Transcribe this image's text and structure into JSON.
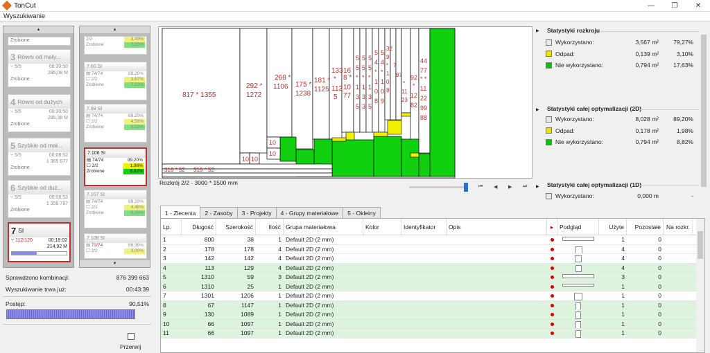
{
  "window": {
    "title": "TonCut",
    "min": "—",
    "max": "❐",
    "close": "✕"
  },
  "menu": {
    "search": "Wyszukiwanie"
  },
  "col1": {
    "top_status": "Zrobione",
    "cards": [
      {
        "num": "3",
        "name": "Równi od mały...",
        "count": "5/5",
        "time": "00:30:50",
        "val": "285,08 M",
        "status": "Zrobione"
      },
      {
        "num": "4",
        "name": "Równi od dużych",
        "count": "5/5",
        "time": "00:30:50",
        "val": "285,38 M",
        "status": "Zrobione"
      },
      {
        "num": "5",
        "name": "Szybkie od mał...",
        "count": "5/5",
        "time": "00:08:52",
        "val": "1 365 677",
        "status": "Zrobione"
      },
      {
        "num": "6",
        "name": "Szybkie od duż...",
        "count": "5/5",
        "time": "00:08:53",
        "val": "1 359 797",
        "status": "Zrobione"
      },
      {
        "num": "7",
        "name": "SI",
        "count": "112/120",
        "time": "00:18:02",
        "val": "214,92 M",
        "status": "",
        "progress": 0.45
      }
    ]
  },
  "col2": {
    "top": {
      "r1": "2/2",
      "v1": "3,49%",
      "v2": "7,30%",
      "status": "Zrobione"
    },
    "cards": [
      {
        "title": "7.60 SI",
        "a": "74/74",
        "va": "89,20%",
        "b": "2/2",
        "vb": "3,67%",
        "vc": "7,13%",
        "status": "Zrobione"
      },
      {
        "title": "7.99 SI",
        "a": "74/74",
        "va": "89,20%",
        "b": "2/2",
        "vb": "4,58%",
        "vc": "6,22%",
        "status": "Zrobione"
      },
      {
        "title": "7.106 SI",
        "a": "74/74",
        "va": "89,20%",
        "b": "2/2",
        "vb": "1,98%",
        "vc": "8,82%",
        "status": "Zrobione"
      },
      {
        "title": "7.107 SI",
        "a": "74/74",
        "va": "89,20%",
        "b": "2/2",
        "vb": "4,46%",
        "vc": "6,34%",
        "status": "Zrobione"
      },
      {
        "title": "7.108 SI",
        "a": "73/74",
        "va": "88,39%",
        "b": "2/2",
        "vb": "3,00%",
        "vc": ""
      }
    ]
  },
  "stats": {
    "checked_label": "Sprawdzono kombinacji:",
    "checked_val": "876 399 663",
    "time_label": "Wyszukiwanie trwa już:",
    "time_val": "00:43:39",
    "progress_label": "Postęp:",
    "progress_val": "90,51%",
    "progress": 0.9051,
    "stop": "Przerwij"
  },
  "viewer": {
    "caption": "Rozkrój 2/2 - 3000 * 1500 mm",
    "labels": [
      "817 * 1355",
      "292 *\n1272",
      "268 *\n1106",
      "175 *\n1238",
      "181 *\n1125",
      "133\n*\n113\n5",
      "16\n8 *\n10\n77"
    ],
    "small": [
      "316 * 52",
      "316 * 52",
      "10",
      "10",
      "10",
      "10"
    ]
  },
  "right": {
    "sect1": "Statystyki rozkroju",
    "s1": [
      {
        "label": "Wykorzystano:",
        "a": "3,567 m²",
        "b": "79,27%",
        "color": "#e8e8e8"
      },
      {
        "label": "Odpad:",
        "a": "0,139 m²",
        "b": "3,10%",
        "color": "#e5e500"
      },
      {
        "label": "Nie wykorzystano:",
        "a": "0,794 m²",
        "b": "17,63%",
        "color": "#10c010"
      }
    ],
    "sect2": "Statystyki całej optymalizacji (2D)",
    "s2": [
      {
        "label": "Wykorzystano:",
        "a": "8,028 m²",
        "b": "89,20%",
        "color": "#e8e8e8"
      },
      {
        "label": "Odpad:",
        "a": "0,178 m²",
        "b": "1,98%",
        "color": "#e5e500"
      },
      {
        "label": "Nie wykorzystano:",
        "a": "0,794 m²",
        "b": "8,82%",
        "color": "#10c010"
      }
    ],
    "sect3": "Statystyki całej optymalizacji (1D)",
    "s3": [
      {
        "label": "Wykorzystano:",
        "a": "0,000 m",
        "b": "-",
        "color": "#e8e8e8"
      }
    ]
  },
  "tabs": [
    "1 - Zlecenia",
    "2 - Zasoby",
    "3 - Projekty",
    "4 - Grupy materiałowe",
    "5 - Okleiny"
  ],
  "table": {
    "headers": [
      "Lp.",
      "Długość",
      "Szerokość",
      "Ilość",
      "Grupa materiałowa",
      "Kolor",
      "Identyfikator",
      "Opis",
      "",
      "Podgląd",
      "Użyte",
      "Pozostałe",
      "Na rozkr."
    ],
    "rows": [
      {
        "lp": "1",
        "l": "800",
        "w": "38",
        "q": "1",
        "g": "Default 2D (2 mm)",
        "u": "1",
        "p": "0",
        "green": false,
        "pw": 46,
        "ph": 6
      },
      {
        "lp": "2",
        "l": "178",
        "w": "178",
        "q": "4",
        "g": "Default 2D (2 mm)",
        "u": "4",
        "p": "0",
        "green": false,
        "pw": 11,
        "ph": 11
      },
      {
        "lp": "3",
        "l": "142",
        "w": "142",
        "q": "4",
        "g": "Default 2D (2 mm)",
        "u": "4",
        "p": "0",
        "green": false,
        "pw": 10,
        "ph": 10
      },
      {
        "lp": "4",
        "l": "113",
        "w": "129",
        "q": "4",
        "g": "Default 2D (2 mm)",
        "u": "4",
        "p": "0",
        "green": true,
        "pw": 9,
        "ph": 10
      },
      {
        "lp": "5",
        "l": "1310",
        "w": "59",
        "q": "3",
        "g": "Default 2D (2 mm)",
        "u": "3",
        "p": "0",
        "green": true,
        "pw": 46,
        "ph": 6
      },
      {
        "lp": "6",
        "l": "1310",
        "w": "25",
        "q": "1",
        "g": "Default 2D (2 mm)",
        "u": "1",
        "p": "0",
        "green": true,
        "pw": 46,
        "ph": 4
      },
      {
        "lp": "7",
        "l": "1301",
        "w": "1206",
        "q": "1",
        "g": "Default 2D (2 mm)",
        "u": "1",
        "p": "0",
        "green": false,
        "pw": 12,
        "ph": 11
      },
      {
        "lp": "8",
        "l": "67",
        "w": "1147",
        "q": "1",
        "g": "Default 2D (2 mm)",
        "u": "1",
        "p": "0",
        "green": true,
        "pw": 5,
        "ph": 11
      },
      {
        "lp": "9",
        "l": "130",
        "w": "1089",
        "q": "1",
        "g": "Default 2D (2 mm)",
        "u": "1",
        "p": "0",
        "green": true,
        "pw": 6,
        "ph": 11
      },
      {
        "lp": "10",
        "l": "66",
        "w": "1097",
        "q": "1",
        "g": "Default 2D (2 mm)",
        "u": "1",
        "p": "0",
        "green": true,
        "pw": 5,
        "ph": 11
      },
      {
        "lp": "11",
        "l": "66",
        "w": "1097",
        "q": "1",
        "g": "Default 2D (2 mm)",
        "u": "1",
        "p": "0",
        "green": true,
        "pw": 5,
        "ph": 11
      }
    ]
  },
  "colors": {
    "green": "#10d010",
    "yellow": "#f0f000",
    "red_label": "#c0302c",
    "selected_border": "#c0302c"
  }
}
